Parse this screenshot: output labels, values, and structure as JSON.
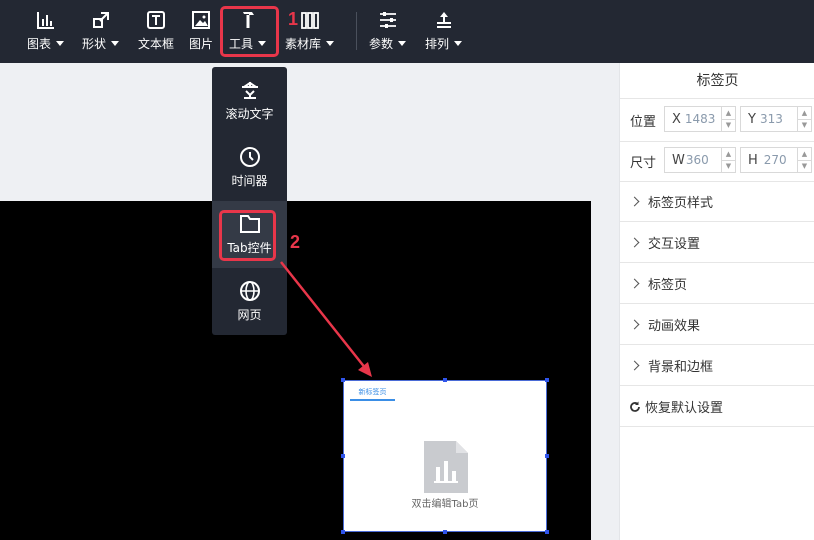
{
  "toolbar": {
    "items": [
      {
        "label": "图表",
        "icon": "bar-chart-icon",
        "has_caret": true
      },
      {
        "label": "形状",
        "icon": "shape-icon",
        "has_caret": true
      },
      {
        "label": "文本框",
        "icon": "textbox-icon",
        "has_caret": false
      },
      {
        "label": "图片",
        "icon": "image-icon",
        "has_caret": false
      },
      {
        "label": "工具",
        "icon": "hammer-icon",
        "has_caret": true
      },
      {
        "label": "素材库",
        "icon": "library-icon",
        "has_caret": true
      },
      {
        "label": "参数",
        "icon": "sliders-icon",
        "has_caret": true
      },
      {
        "label": "排列",
        "icon": "arrange-icon",
        "has_caret": true
      }
    ]
  },
  "annotations": {
    "step1": "1",
    "step2": "2",
    "highlight_color": "#e8364a"
  },
  "tools_menu": {
    "items": [
      {
        "label": "滚动文字",
        "icon": "marquee-icon"
      },
      {
        "label": "时间器",
        "icon": "clock-icon"
      },
      {
        "label": "Tab控件",
        "icon": "folder-tab-icon"
      },
      {
        "label": "网页",
        "icon": "globe-icon"
      }
    ]
  },
  "widget": {
    "tab_label": "新标签页",
    "caption": "双击编辑Tab页"
  },
  "panel": {
    "title": "标签页",
    "position_label": "位置",
    "x_prefix": "X",
    "x_value": "1483",
    "y_prefix": "Y",
    "y_value": "313",
    "size_label": "尺寸",
    "w_prefix": "W",
    "w_value": "360",
    "h_prefix": "H",
    "h_value": "270",
    "sections": [
      "标签页样式",
      "交互设置",
      "标签页",
      "动画效果",
      "背景和边框"
    ],
    "reset_label": "恢复默认设置"
  },
  "colors": {
    "toolbar_bg": "#232833",
    "accent": "#3a8ee6",
    "selection": "#2f54eb"
  }
}
